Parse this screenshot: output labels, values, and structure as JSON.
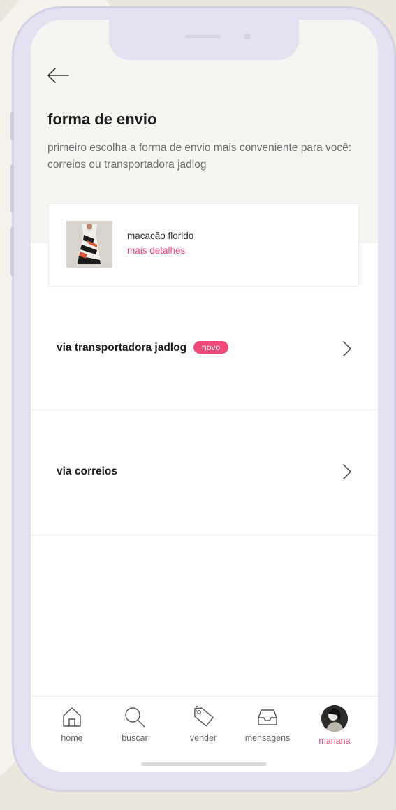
{
  "header": {
    "back_icon": "arrow-left-icon",
    "title": "forma de envio",
    "subtitle": "primeiro escolha a forma de envio mais conveniente para você: correios ou transportadora jadlog"
  },
  "product": {
    "name": "macacão florido",
    "details_link": "mais detalhes"
  },
  "shipping_options": [
    {
      "label": "via transportadora jadlog",
      "badge": "novo"
    },
    {
      "label": "via correios",
      "badge": ""
    }
  ],
  "bottom_nav": {
    "items": [
      {
        "label": "home",
        "icon": "home-icon",
        "active": false
      },
      {
        "label": "buscar",
        "icon": "search-icon",
        "active": false
      },
      {
        "label": "vender",
        "icon": "tag-icon",
        "active": false
      },
      {
        "label": "mensagens",
        "icon": "inbox-icon",
        "active": false
      },
      {
        "label": "mariana",
        "icon": "avatar",
        "active": true
      }
    ]
  },
  "colors": {
    "accent": "#ef4a7a",
    "text_primary": "#1f1f1f",
    "text_secondary": "#6e6e6e",
    "header_bg": "#f6f5f2"
  }
}
